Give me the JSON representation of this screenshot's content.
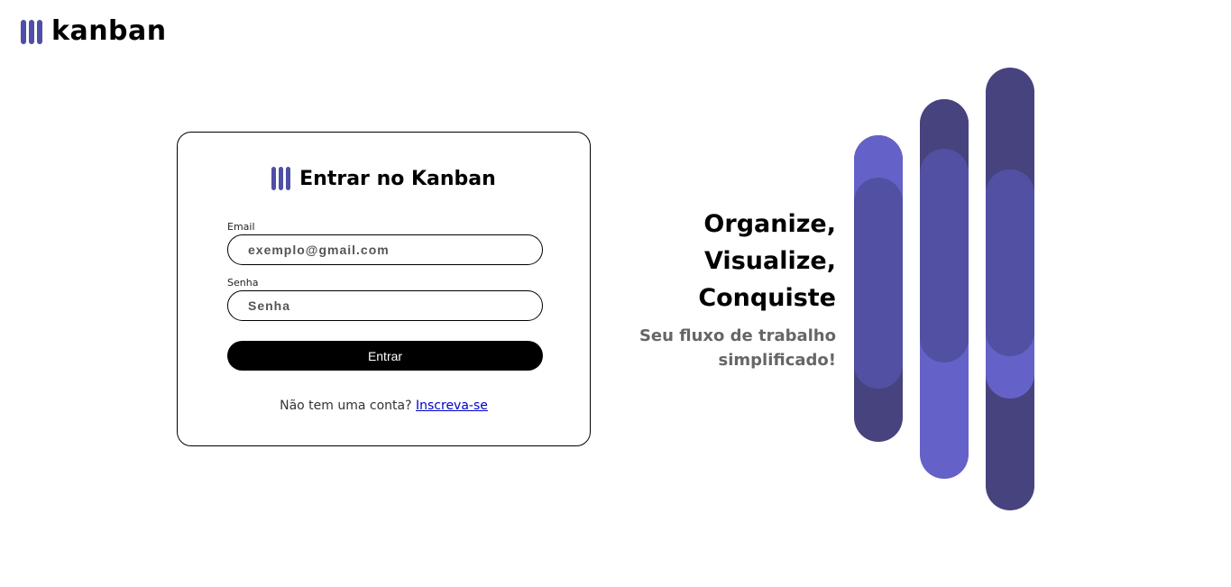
{
  "brand": {
    "name": "kanban",
    "icon": "kanban-bars-icon",
    "accent_color": "#4f4fa6"
  },
  "login": {
    "title": "Entrar no Kanban",
    "email_label": "Email",
    "email_placeholder": "exemplo@gmail.com",
    "password_label": "Senha",
    "password_placeholder": "Senha",
    "submit_label": "Entrar",
    "signup_prompt": "Não tem uma conta?",
    "signup_link": "Inscreva-se"
  },
  "hero": {
    "headline_1": "Organize,",
    "headline_2": "Visualize,",
    "headline_3": "Conquiste",
    "subtitle_1": "Seu fluxo de trabalho",
    "subtitle_2": "simplificado!"
  },
  "colors": {
    "pill_dark": "#47437e",
    "pill_mid": "#5250a3",
    "pill_light": "#6462c8",
    "button_bg": "#000000",
    "link": "#0000cc"
  }
}
